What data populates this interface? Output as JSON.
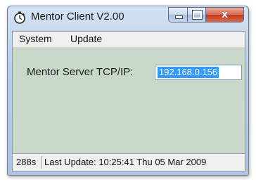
{
  "window": {
    "title": "Mentor Client V2.00",
    "icon": "stopwatch-icon"
  },
  "caption_buttons": {
    "minimize_icon": "minimize-icon",
    "maximize_icon": "maximize-icon",
    "close_icon": "close-icon",
    "close_glyph": "x"
  },
  "menu": {
    "items": [
      {
        "label": "System"
      },
      {
        "label": "Update"
      }
    ]
  },
  "server": {
    "label": "Mentor Server TCP/IP:",
    "value": "192.168.0.156"
  },
  "status": {
    "elapsed": "288s",
    "last_update": "Last Update: 10:25:41 Thu 05 Mar 2009"
  },
  "colors": {
    "selection": "#3399ff",
    "client_background": "#c9d9c9",
    "close_button": "#c2381c"
  }
}
